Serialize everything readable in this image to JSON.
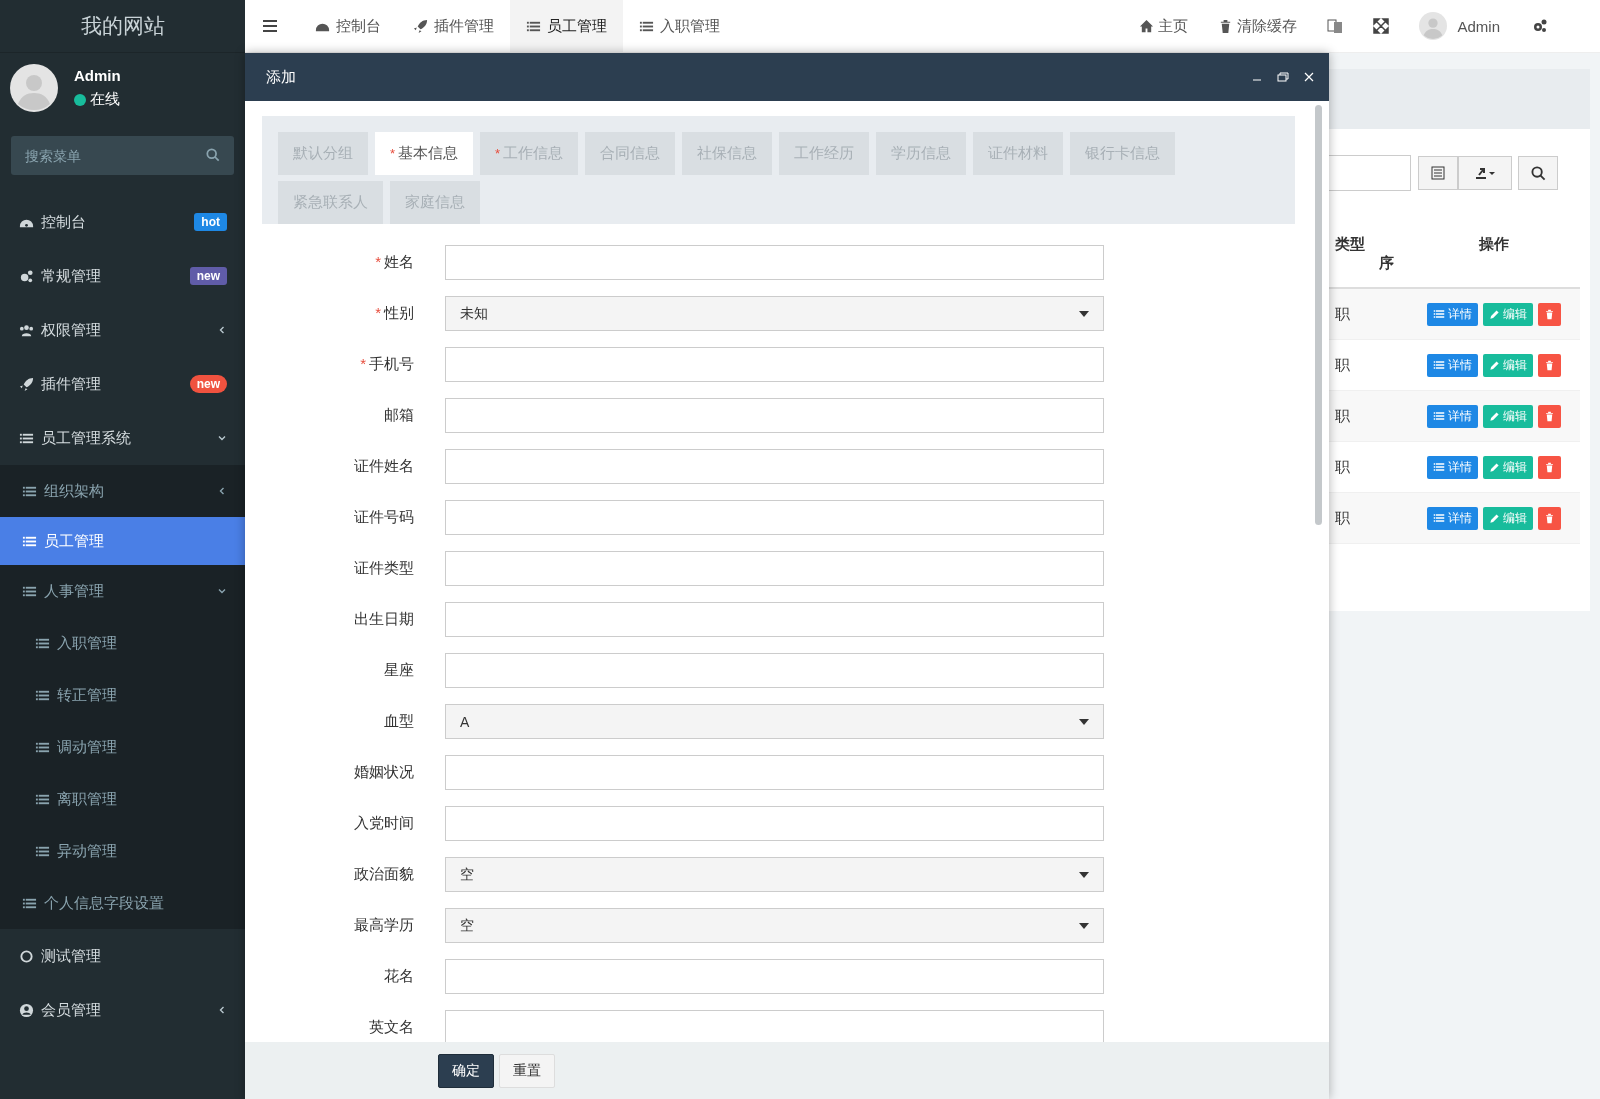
{
  "sidebar": {
    "site_title": "我的网站",
    "user": {
      "name": "Admin",
      "status": "在线"
    },
    "search": {
      "placeholder": "搜索菜单"
    },
    "menu": [
      {
        "label": "控制台",
        "selected": false,
        "badge": {
          "text": "hot",
          "color": "#1e88e5"
        }
      },
      {
        "label": "常规管理",
        "selected": false,
        "badge": {
          "text": "new",
          "color": "#605ca8"
        }
      },
      {
        "label": "权限管理",
        "selected": false,
        "expanded": false
      },
      {
        "label": "插件管理",
        "selected": false,
        "badge": {
          "text": "new",
          "color": "#f0523f"
        }
      },
      {
        "label": "员工管理系统",
        "selected": false,
        "expanded": true,
        "children": [
          {
            "label": "组织架构",
            "selected": false,
            "expanded": false
          },
          {
            "label": "员工管理",
            "selected": true
          },
          {
            "label": "人事管理",
            "selected": false,
            "expanded": true,
            "children": [
              {
                "label": "入职管理",
                "selected": false
              },
              {
                "label": "转正管理",
                "selected": false
              },
              {
                "label": "调动管理",
                "selected": false
              },
              {
                "label": "离职管理",
                "selected": false
              },
              {
                "label": "异动管理",
                "selected": false
              }
            ]
          },
          {
            "label": "个人信息字段设置",
            "selected": false
          }
        ]
      },
      {
        "label": "测试管理",
        "selected": false
      },
      {
        "label": "会员管理",
        "selected": false,
        "expanded": false
      }
    ]
  },
  "top_nav": {
    "tabs": [
      {
        "label": "控制台",
        "selected": false
      },
      {
        "label": "插件管理",
        "selected": false
      },
      {
        "label": "员工管理",
        "selected": true
      },
      {
        "label": "入职管理",
        "selected": false
      }
    ],
    "links": [
      "主页",
      "清除缓存"
    ],
    "user": "Admin"
  },
  "background_table": {
    "columns": [
      "类型",
      "序",
      "操作"
    ],
    "rows": [
      {
        "column_1": "职",
        "actions": [
          "详情",
          "编辑"
        ]
      },
      {
        "column_1": "职",
        "actions": [
          "详情",
          "编辑"
        ]
      },
      {
        "column_1": "职",
        "actions": [
          "详情",
          "编辑"
        ]
      },
      {
        "column_1": "职",
        "actions": [
          "详情",
          "编辑"
        ]
      },
      {
        "column_1": "职",
        "actions": [
          "详情",
          "编辑"
        ]
      }
    ]
  },
  "dialog": {
    "title": "添加",
    "tabs": [
      {
        "label": "默认分组",
        "selected": false
      },
      {
        "required_mark": "*",
        "label": "基本信息",
        "selected": true
      },
      {
        "required_mark": "*",
        "label": "工作信息",
        "selected": false
      },
      {
        "label": "合同信息",
        "selected": false
      },
      {
        "label": "社保信息",
        "selected": false
      },
      {
        "label": "工作经历",
        "selected": false
      },
      {
        "label": "学历信息",
        "selected": false
      },
      {
        "label": "证件材料",
        "selected": false
      },
      {
        "label": "银行卡信息",
        "selected": false
      },
      {
        "label": "紧急联系人",
        "selected": false
      },
      {
        "label": "家庭信息",
        "selected": false
      }
    ],
    "fields": [
      {
        "kind": "input",
        "required_mark": "*",
        "label": "姓名"
      },
      {
        "kind": "select",
        "required_mark": "*",
        "label": "性别",
        "value": "未知"
      },
      {
        "kind": "input",
        "required_mark": "*",
        "label": "手机号"
      },
      {
        "kind": "input",
        "label": "邮箱"
      },
      {
        "kind": "input",
        "label": "证件姓名"
      },
      {
        "kind": "input",
        "label": "证件号码"
      },
      {
        "kind": "input",
        "label": "证件类型"
      },
      {
        "kind": "input",
        "label": "出生日期"
      },
      {
        "kind": "input",
        "label": "星座"
      },
      {
        "kind": "select",
        "label": "血型",
        "value": "A"
      },
      {
        "kind": "input",
        "label": "婚姻状况"
      },
      {
        "kind": "input",
        "label": "入党时间"
      },
      {
        "kind": "select",
        "label": "政治面貌",
        "value": "空"
      },
      {
        "kind": "select",
        "label": "最高学历",
        "value": "空"
      },
      {
        "kind": "input",
        "label": "花名"
      },
      {
        "kind": "input",
        "label": "英文名"
      }
    ],
    "buttons": [
      "确定",
      "重置"
    ]
  }
}
